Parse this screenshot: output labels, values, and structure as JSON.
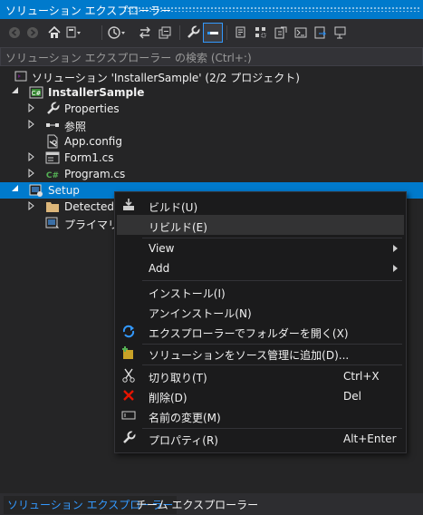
{
  "window": {
    "title": "ソリューション エクスプローラー"
  },
  "search": {
    "placeholder": "ソリューション エクスプローラー の検索 (Ctrl+:)"
  },
  "toolbar": {
    "icons": [
      "back-icon",
      "forward-icon",
      "home-icon",
      "switch-views-icon",
      "history-icon",
      "sync-icon",
      "collapse-all-icon",
      "properties-icon",
      "preview-icon",
      "pending-changes-icon",
      "show-all-files-icon",
      "refresh-icon",
      "view-code-icon",
      "view-designer-icon",
      "file-system-icon"
    ]
  },
  "tree": {
    "solution": "ソリューション 'InstallerSample' (2/2 プロジェクト)",
    "project": "InstallerSample",
    "properties": "Properties",
    "references": "参照",
    "app_config": "App.config",
    "form1": "Form1.cs",
    "program": "Program.cs",
    "setup": "Setup",
    "detected": "Detected D",
    "primary": "プライマリ出"
  },
  "context_menu": {
    "build": "ビルド(U)",
    "rebuild": "リビルド(E)",
    "view": "View",
    "add": "Add",
    "install": "インストール(I)",
    "uninstall": "アンインストール(N)",
    "open_folder": "エクスプローラーでフォルダーを開く(X)",
    "add_source_control": "ソリューションをソース管理に追加(D)...",
    "cut": "切り取り(T)",
    "cut_shortcut": "Ctrl+X",
    "delete": "削除(D)",
    "delete_shortcut": "Del",
    "rename": "名前の変更(M)",
    "properties": "プロパティ(R)",
    "properties_shortcut": "Alt+Enter"
  },
  "tabs": {
    "solution_explorer": "ソリューション エクスプローラー",
    "team_explorer": "チーム エクスプローラー"
  },
  "colors": {
    "accent": "#007acc",
    "background": "#252526",
    "menu": "#1b1b1c",
    "highlight": "#333334"
  }
}
